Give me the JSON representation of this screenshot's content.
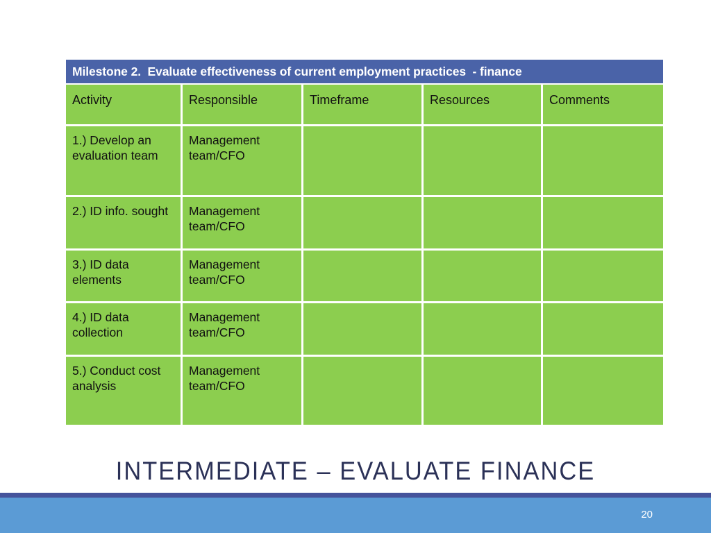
{
  "slide": {
    "title": "INTERMEDIATE – EVALUATE FINANCE",
    "page_number": "20",
    "background_color": "#ffffff"
  },
  "colors": {
    "milestone_header_blue": "#4A63A8",
    "table_green": "#8CCE4F",
    "gridline_white": "#ffffff",
    "title_navy": "#2B3157",
    "footer_rule_navy": "#45539B",
    "footer_band_blue": "#5B9BD5"
  },
  "table": {
    "milestone_header": "Milestone 2.  Evaluate effectiveness of current employment practices  - finance",
    "columns": [
      "Activity",
      "Responsible",
      "Timeframe",
      "Resources",
      "Comments"
    ],
    "rows": [
      {
        "activity": "1.) Develop an evaluation team",
        "responsible": "Management team/CFO",
        "timeframe": "",
        "resources": "",
        "comments": ""
      },
      {
        "activity": "2.) ID info. sought",
        "responsible": "Management team/CFO",
        "timeframe": "",
        "resources": "",
        "comments": ""
      },
      {
        "activity": "3.) ID data elements",
        "responsible": "Management team/CFO",
        "timeframe": "",
        "resources": "",
        "comments": ""
      },
      {
        "activity": "4.) ID data collection",
        "responsible": "Management team/CFO",
        "timeframe": "",
        "resources": "",
        "comments": ""
      },
      {
        "activity": "5.)  Conduct cost analysis",
        "responsible": "Management team/CFO",
        "timeframe": "",
        "resources": "",
        "comments": ""
      }
    ]
  }
}
